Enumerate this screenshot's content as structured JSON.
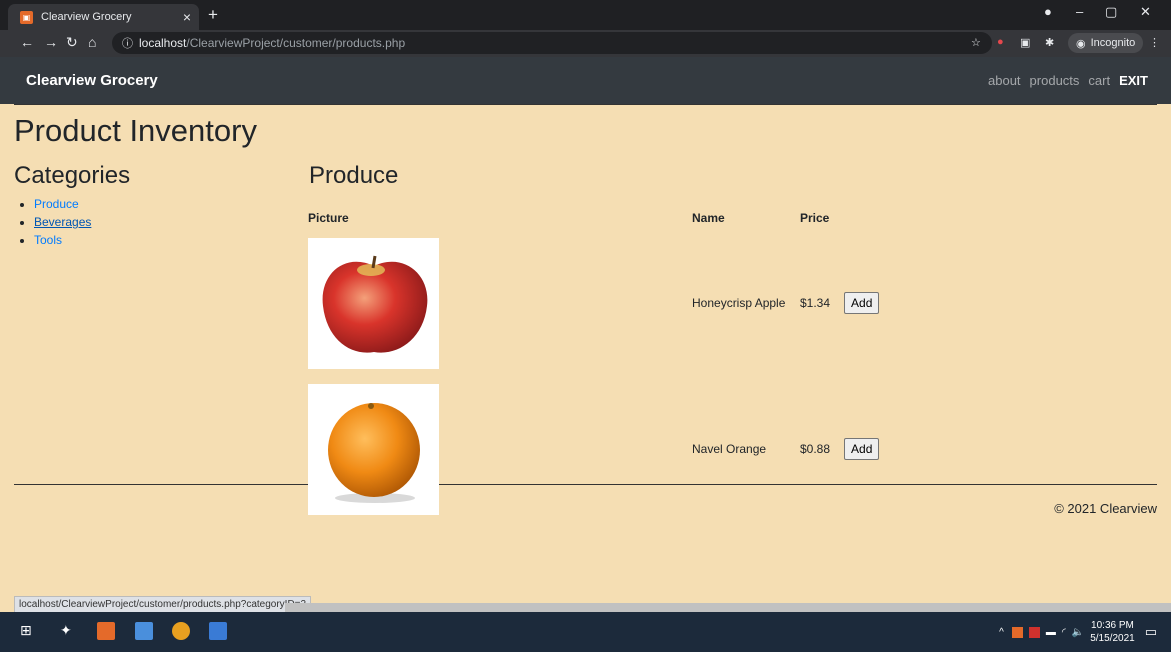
{
  "browser": {
    "tab_title": "Clearview Grocery",
    "tab_close": "×",
    "new_tab": "+",
    "url_host": "localhost",
    "url_path": "/ClearviewProject/customer/products.php",
    "incognito_label": "Incognito",
    "status_url": "localhost/ClearviewProject/customer/products.php?categoryID=2"
  },
  "navbar": {
    "brand": "Clearview Grocery",
    "links": [
      "about",
      "products",
      "cart",
      "EXIT"
    ]
  },
  "page": {
    "title": "Product Inventory",
    "categories_heading": "Categories",
    "categories": [
      "Produce",
      "Beverages",
      "Tools"
    ],
    "section_heading": "Produce",
    "table": {
      "headers": [
        "Picture",
        "Name",
        "Price"
      ],
      "rows": [
        {
          "name": "Honeycrisp Apple",
          "price": "$1.34",
          "button": "Add",
          "image": "apple"
        },
        {
          "name": "Navel Orange",
          "price": "$0.88",
          "button": "Add",
          "image": "orange"
        }
      ]
    },
    "footer": "© 2021 Clearview"
  },
  "taskbar": {
    "time": "10:36 PM",
    "date": "5/15/2021"
  },
  "colors": {
    "page_bg": "#f5deb3",
    "navbar_bg": "#343a40",
    "link": "#007bff"
  }
}
